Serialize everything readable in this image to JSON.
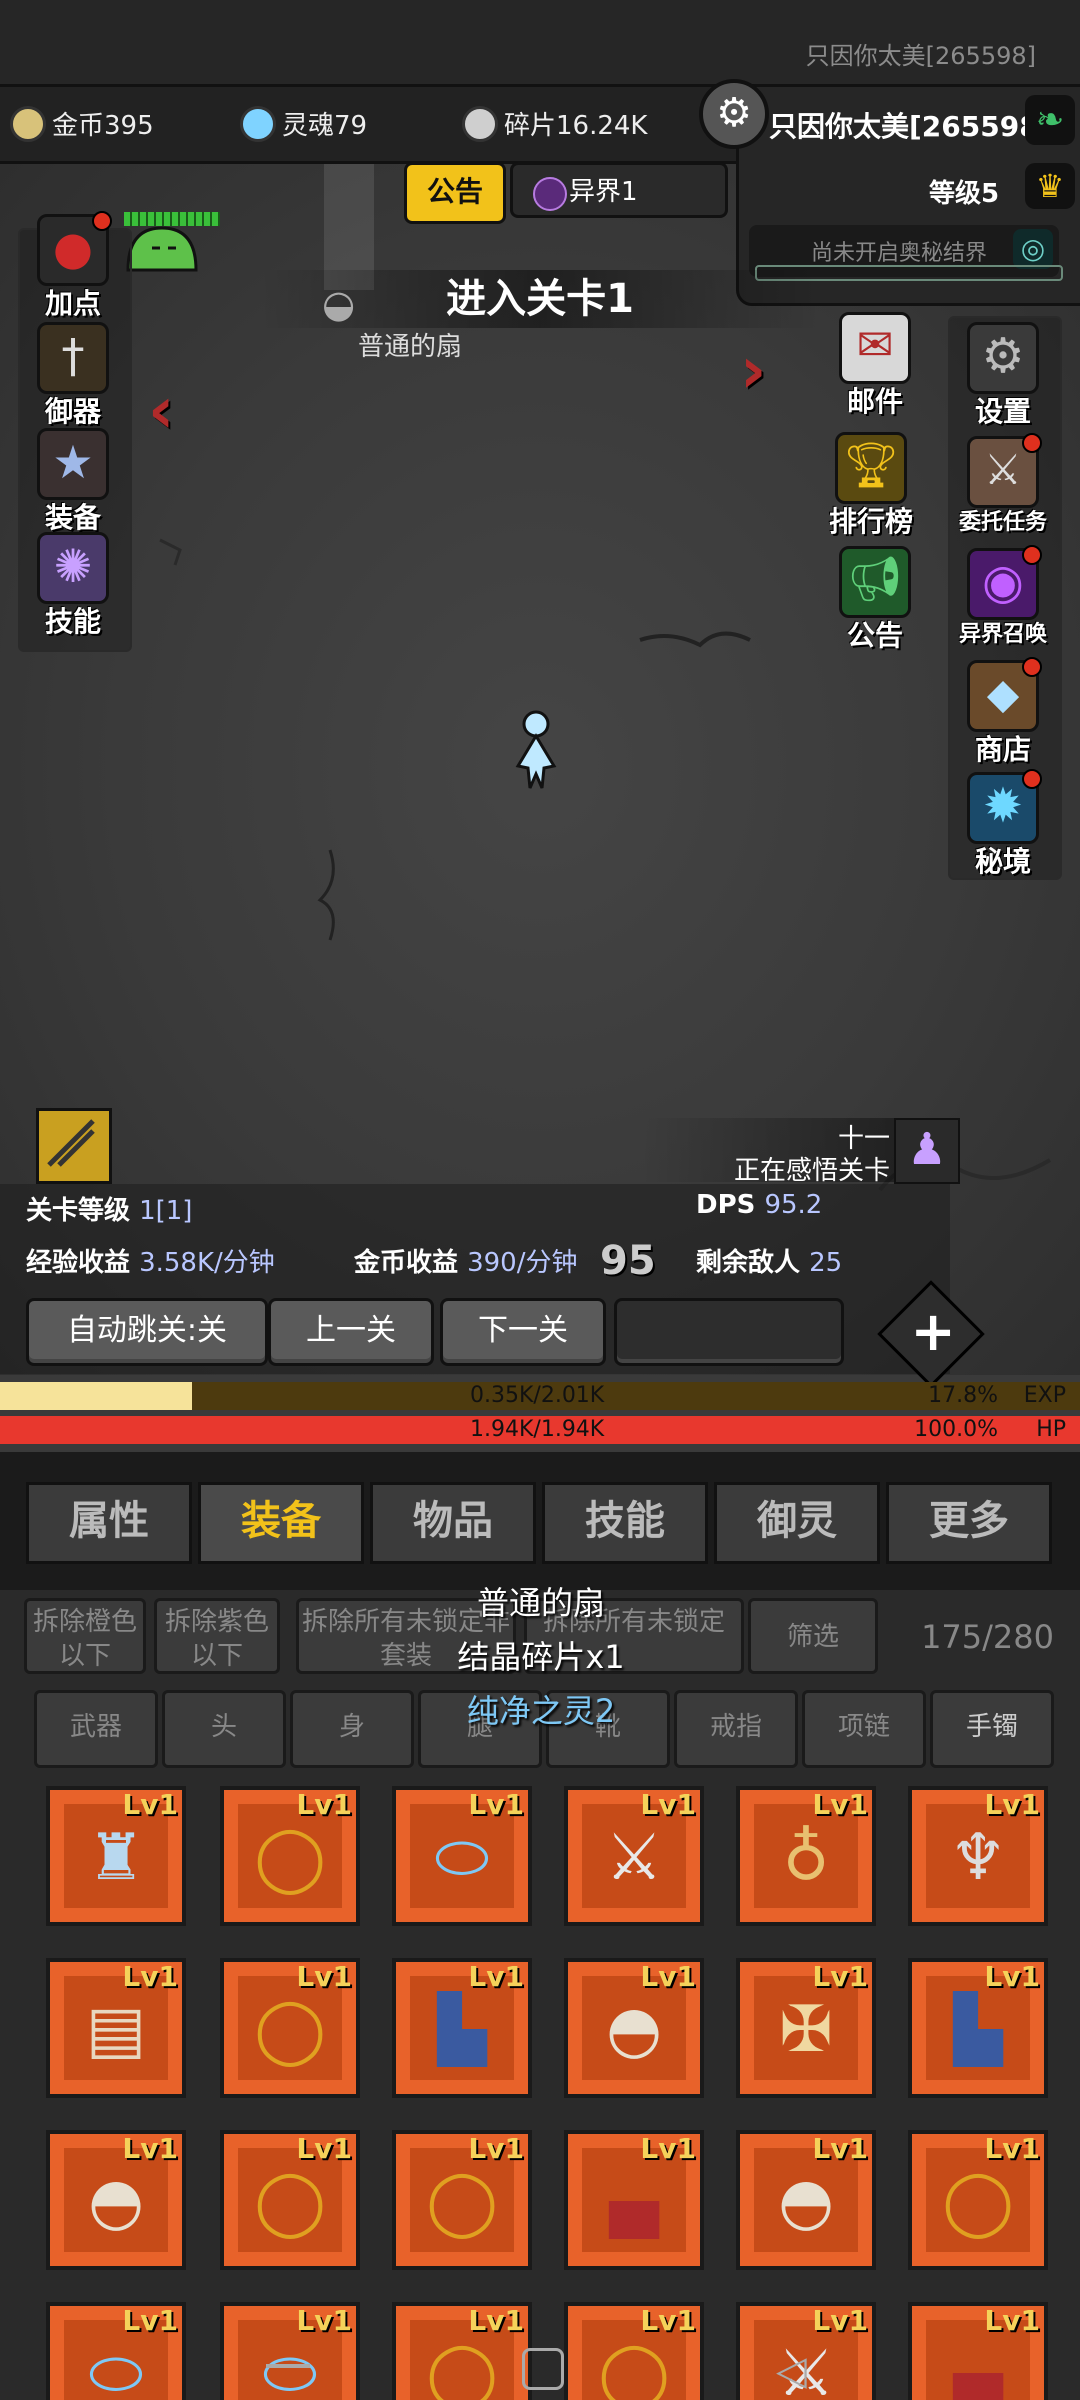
{
  "player_name_top": "只因你太美[265598]",
  "resources": [
    {
      "label": "金币395",
      "icon": "gold-coin-icon",
      "color": "#d8c27a"
    },
    {
      "label": "灵魂79",
      "icon": "soul-icon",
      "color": "#7fd3ff"
    },
    {
      "label": "碎片16.24K",
      "icon": "shard-icon",
      "color": "#cfcfcf"
    }
  ],
  "player": {
    "name": "只因你太美[265598]",
    "level": "等级5",
    "secret_realm": "尚未开启奥秘结界"
  },
  "notice_tab": "公告",
  "otherworld_tab": "异界1",
  "stage_banner": "进入关卡1",
  "item_drop": "普通的扇",
  "left_menu": [
    "加点",
    "御器",
    "装备",
    "技能"
  ],
  "right_menu_col1": [
    "邮件",
    "排行榜",
    "公告"
  ],
  "right_menu_col2": [
    "设置",
    "委托任务",
    "异界召唤",
    "商店",
    "秘境"
  ],
  "comprehend": {
    "title": "十一",
    "status": "正在感悟关卡"
  },
  "stats": {
    "stage_level_label": "关卡等级",
    "stage_level": "1[1]",
    "dps_label": "DPS",
    "dps": "95.2",
    "exp_label": "经验收益",
    "exp": "3.58K/分钟",
    "gold_label": "金币收益",
    "gold": "390/分钟",
    "floating_damage": "95",
    "enemies_label": "剩余敌人",
    "enemies": "25"
  },
  "buttons": {
    "auto_skip": "自动跳关:关",
    "prev": "上一关",
    "next": "下一关",
    "plus": "+"
  },
  "exp_bar": {
    "text": "0.35K/2.01K",
    "percent": "17.8%",
    "unit": "EXP",
    "fill": 0.178
  },
  "hp_bar": {
    "text": "1.94K/1.94K",
    "percent": "100.0%",
    "unit": "HP",
    "fill": 1.0
  },
  "tabs": [
    "属性",
    "装备",
    "物品",
    "技能",
    "御灵",
    "更多"
  ],
  "active_tab": "装备",
  "inventory": {
    "filters": [
      "拆除橙色以下",
      "拆除紫色以下",
      "拆除所有未锁定非套装",
      "拆除所有未锁定",
      "筛选"
    ],
    "count": "175/280",
    "slots": [
      "武器",
      "头",
      "身",
      "腿",
      "靴",
      "戒指",
      "项链",
      "手镯"
    ]
  },
  "tooltip": {
    "name": "普通的扇",
    "reward": "结晶碎片x1",
    "spirit": "纯净之灵2"
  },
  "item_level": "Lv1",
  "items": [
    "armor-icon",
    "ring-icon",
    "bracelet-icon",
    "sword-icon",
    "necklace-icon",
    "halberd-icon",
    "chest-icon",
    "ring-icon",
    "boot-icon",
    "hat-icon",
    "crossbow-icon",
    "boot-icon",
    "hat-icon",
    "ring-icon",
    "ring-icon",
    "shoe-icon",
    "hat-icon",
    "ring-icon",
    "bracelet-icon",
    "bracelet-icon",
    "ring-icon",
    "ring-icon",
    "sword-icon",
    "shoe-icon"
  ]
}
